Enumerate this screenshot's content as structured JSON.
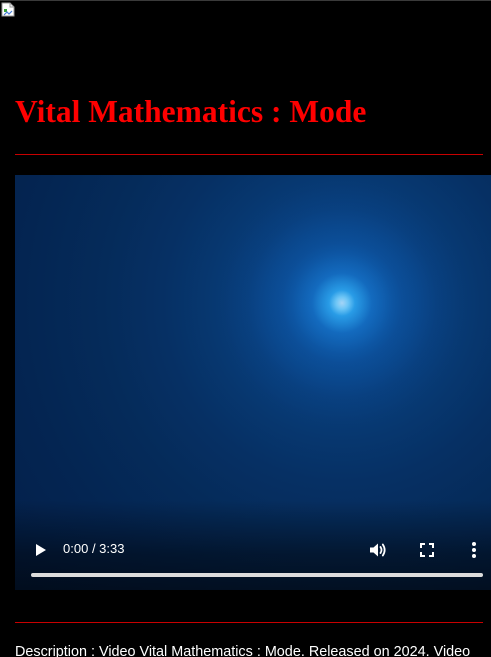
{
  "page": {
    "title": "Vital Mathematics : Mode",
    "description": "Description : Video Vital Mathematics : Mode. Released on 2024. Video"
  },
  "player": {
    "current_time": "0:00",
    "duration": "3:33",
    "time_display": "0:00 / 3:33",
    "progress": 0,
    "volume_state": "on",
    "icons": {
      "play": "play-icon",
      "volume": "volume-icon",
      "fullscreen": "fullscreen-icon",
      "more": "more-vert-icon",
      "broken_image": "broken-image-icon"
    }
  },
  "colors": {
    "background": "#000000",
    "title": "#ff0000",
    "divider": "#c80000",
    "text": "#ffffff",
    "video_glow": "#8fe3ff",
    "video_background": "#063064"
  }
}
